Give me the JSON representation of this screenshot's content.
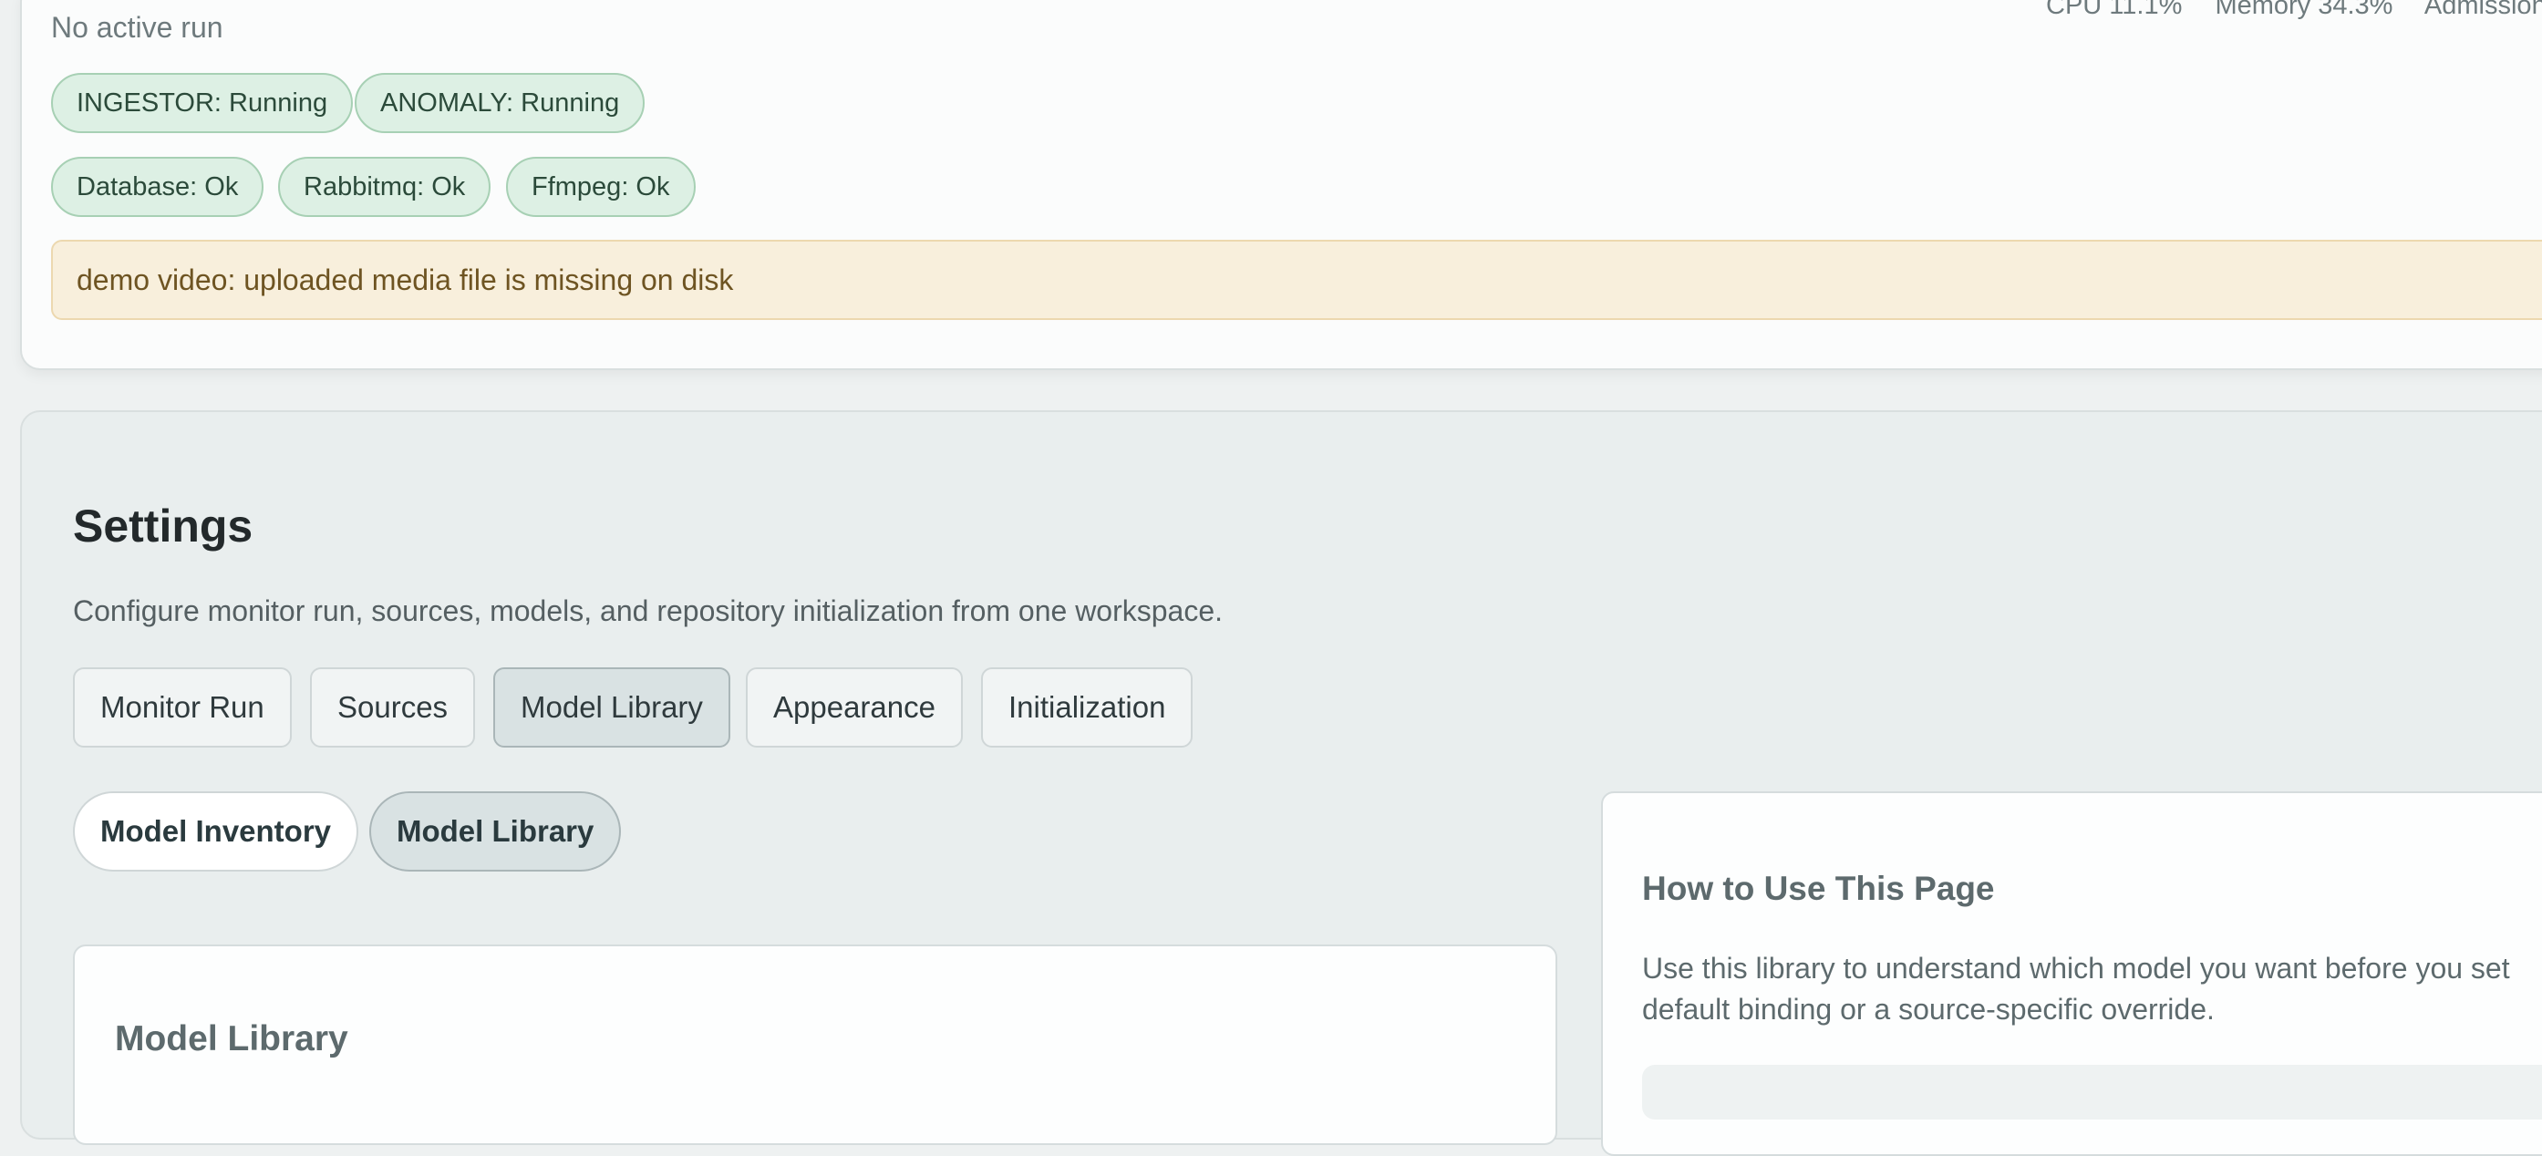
{
  "status": {
    "run_status": "No active run",
    "metrics": {
      "cpu": "CPU 11.1%",
      "memory": "Memory 34.3%",
      "admission": "Admission"
    },
    "services": [
      {
        "label": "INGESTOR: Running"
      },
      {
        "label": "ANOMALY: Running"
      }
    ],
    "health": [
      {
        "label": "Database: Ok"
      },
      {
        "label": "Rabbitmq: Ok"
      },
      {
        "label": "Ffmpeg: Ok"
      }
    ],
    "warning": "demo video: uploaded media file is missing on disk",
    "status_color": "#ddf0e4",
    "warning_color": "#f8efdc"
  },
  "settings": {
    "title": "Settings",
    "description": "Configure monitor run, sources, models, and repository initialization from one workspace.",
    "tabs": [
      {
        "label": "Monitor Run"
      },
      {
        "label": "Sources"
      },
      {
        "label": "Model Library",
        "active": true
      },
      {
        "label": "Appearance"
      },
      {
        "label": "Initialization"
      }
    ],
    "subtabs": [
      {
        "label": "Model Inventory"
      },
      {
        "label": "Model Library",
        "active": true
      }
    ],
    "library_panel": {
      "heading": "Model Library"
    },
    "help_panel": {
      "heading": "How to Use This Page",
      "text": "Use this library to understand which model you want before you set default binding or a source-specific override."
    }
  }
}
